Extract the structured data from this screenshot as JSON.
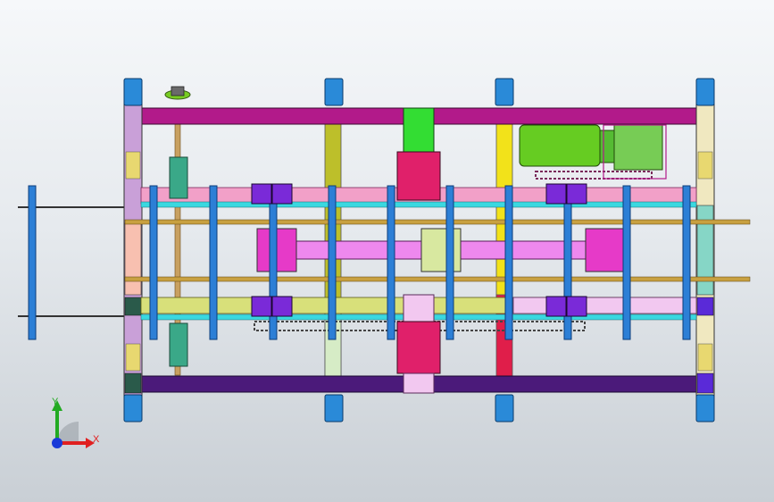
{
  "viewport": {
    "kind": "cad-top-view",
    "background_top": "#f6f8fa",
    "background_bottom": "#c9cfd5"
  },
  "parts": {
    "frame_rail_top": "#b21a8a",
    "frame_rail_bottom": "#4b1a7a",
    "mount_feet": "#2a8ad8",
    "end_posts_left": "#c9a0d8",
    "end_posts_right": "#f0e8c0",
    "conveyor_rollers": "#2c7fd6",
    "guide_rail_upper": "#f2a0c8",
    "guide_rail_lower": "#d8e07a",
    "center_beam": "#ee88ee",
    "lift_block_top": "#e0206a",
    "lift_block_bottom": "#e0206a",
    "motor": "#66cc22",
    "gearbox": "#55bb33",
    "chain": "#444444",
    "vertical_bar_olive": "#bdbf2a",
    "vertical_bar_yellow": "#f2e21a",
    "vertical_bar_red": "#e01e4a",
    "left_block_teal": "#3aa888",
    "hand_wheel": "#77cc22"
  },
  "triad": {
    "x_label": "X",
    "y_label": "Y",
    "x_color": "#e02020",
    "y_color": "#22aa22",
    "origin_color": "#1a3ad8"
  }
}
